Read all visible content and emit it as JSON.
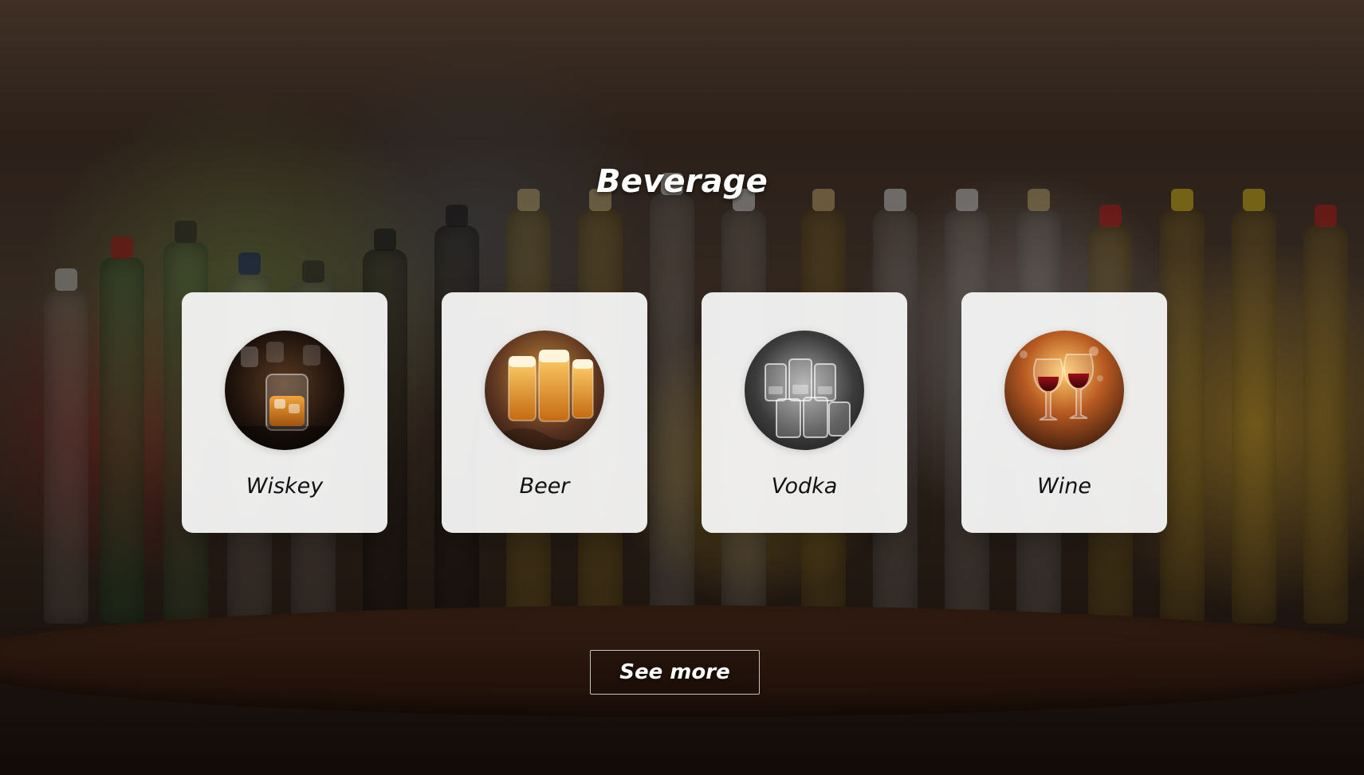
{
  "page": {
    "title": "Beverage"
  },
  "cards": [
    {
      "label": "Wiskey",
      "icon": "whiskey-glass-icon"
    },
    {
      "label": "Beer",
      "icon": "beer-mugs-icon"
    },
    {
      "label": "Vodka",
      "icon": "vodka-shot-glasses-icon"
    },
    {
      "label": "Wine",
      "icon": "wine-glasses-icon"
    }
  ],
  "actions": {
    "see_more_label": "See more"
  },
  "colors": {
    "overlay": "#000000",
    "card_bg": "#f4f4f4",
    "title_text": "#ffffff",
    "label_text": "#111111"
  }
}
